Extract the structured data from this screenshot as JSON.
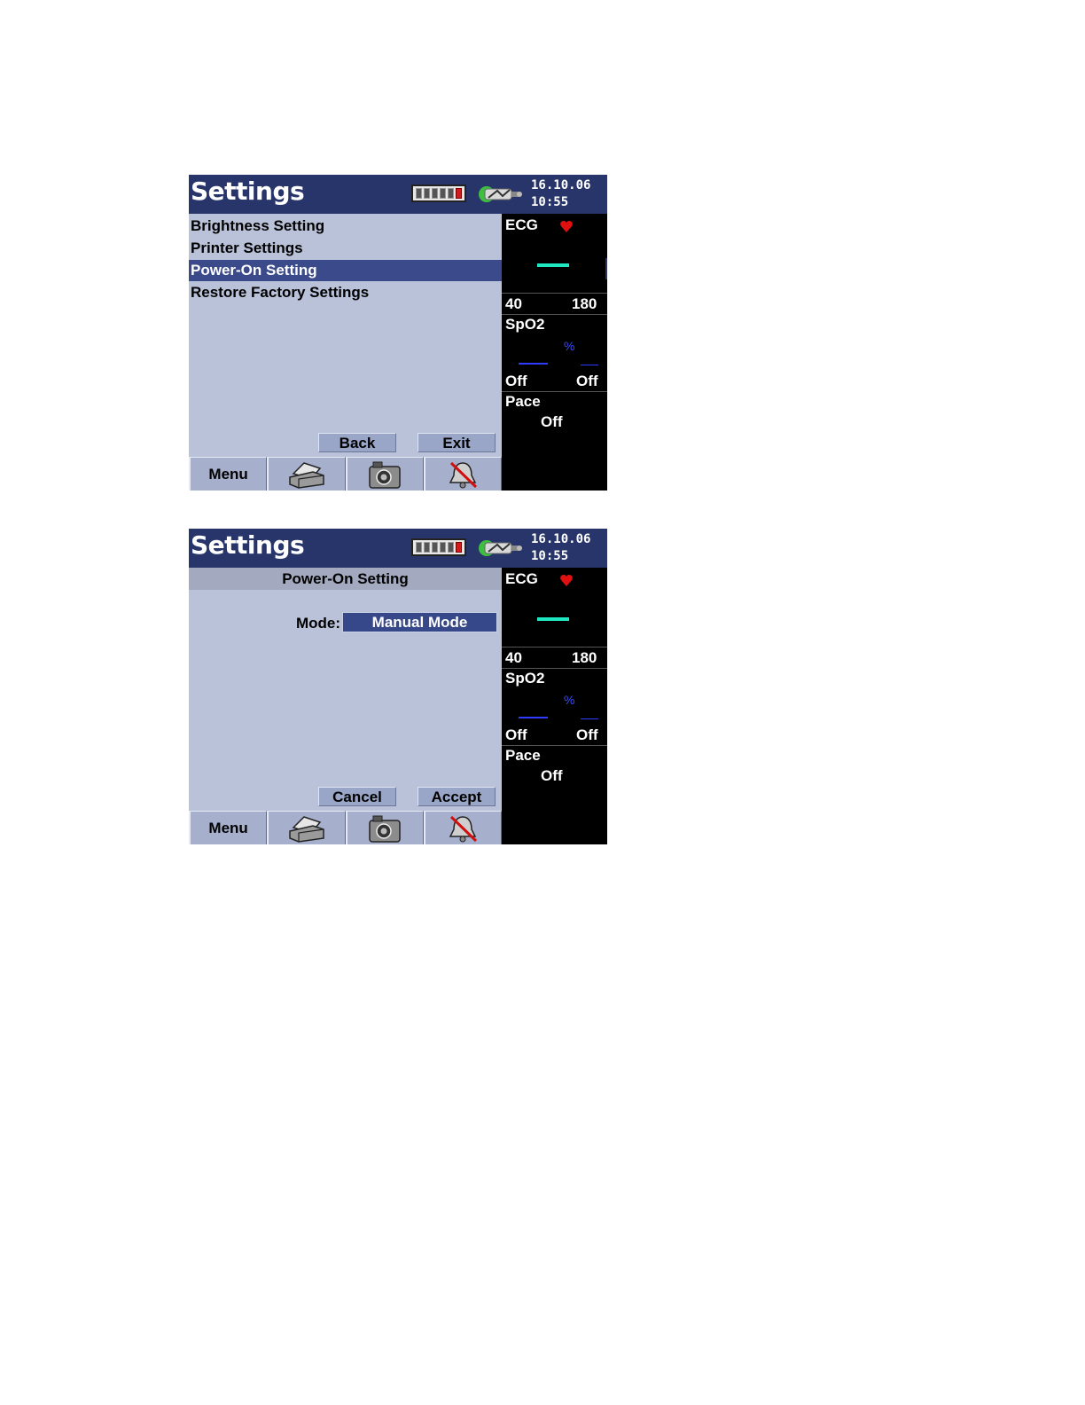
{
  "screens": [
    {
      "title": "Settings",
      "date": "16.10.06",
      "time": "10:55",
      "menu_items": [
        "Brightness Setting",
        "Printer Settings",
        "Power-On Setting",
        "Restore Factory Settings"
      ],
      "selected_item": "Power-On Setting",
      "buttons": {
        "back": "Back",
        "exit": "Exit"
      },
      "toolbar": {
        "menu": "Menu",
        "print_icon": "printer-icon",
        "snapshot_icon": "camera-icon",
        "alarm_icon": "alarm-off-icon"
      },
      "side_panel": {
        "ecg_label": "ECG",
        "ecg_low": "40",
        "ecg_high": "180",
        "spo2_label": "SpO2",
        "spo2_unit": "%",
        "spo2_low": "Off",
        "spo2_high": "Off",
        "pace_label": "Pace",
        "pace_value": "Off"
      }
    },
    {
      "title": "Settings",
      "date": "16.10.06",
      "time": "10:55",
      "subheader": "Power-On Setting",
      "mode_label": "Mode:",
      "mode_value": "Manual Mode",
      "buttons": {
        "cancel": "Cancel",
        "accept": "Accept"
      },
      "toolbar": {
        "menu": "Menu",
        "print_icon": "printer-icon",
        "snapshot_icon": "camera-icon",
        "alarm_icon": "alarm-off-icon"
      },
      "side_panel": {
        "ecg_label": "ECG",
        "ecg_low": "40",
        "ecg_high": "180",
        "spo2_label": "SpO2",
        "spo2_unit": "%",
        "spo2_low": "Off",
        "spo2_high": "Off",
        "pace_label": "Pace",
        "pace_value": "Off"
      }
    }
  ],
  "colors": {
    "title_bar": "#28356a",
    "panel_bg": "#b9c2d9",
    "selection": "#3b4a8a",
    "ecg_trace": "#1de8c1",
    "spo2_trace": "#2f3cff",
    "heart": "#e01010",
    "battery_low": "#d41a1a"
  }
}
